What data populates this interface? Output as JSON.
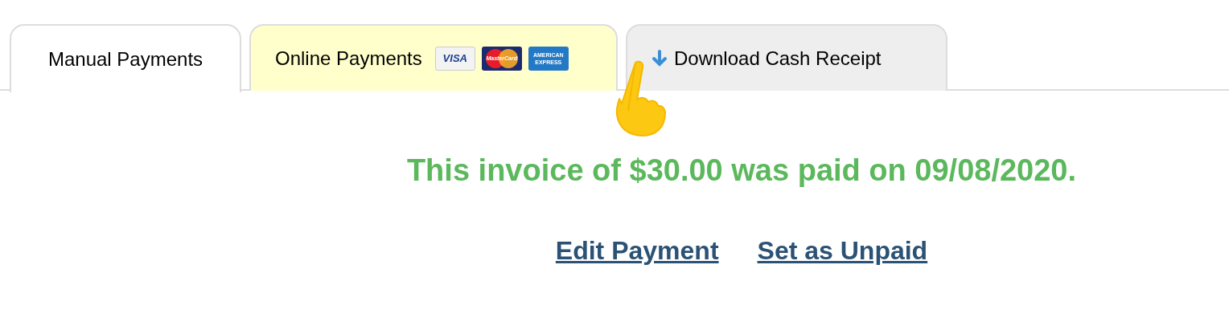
{
  "tabs": [
    {
      "label": "Manual Payments",
      "selected": true,
      "color": "#ffffff",
      "kind": "plain"
    },
    {
      "label": "Online Payments",
      "selected": false,
      "color": "#ffffcc",
      "kind": "cards",
      "cards": [
        {
          "kind": "visa",
          "lines": [
            "VISA"
          ]
        },
        {
          "kind": "mastercard",
          "lines": [
            "MasterCard"
          ]
        },
        {
          "kind": "amex",
          "lines": [
            "AMERICAN",
            "EXPRESS"
          ]
        }
      ]
    },
    {
      "label": "Download Cash Receipt",
      "selected": false,
      "color": "#eeeeee",
      "kind": "download"
    }
  ],
  "message": "This invoice of $30.00 was paid on 09/08/2020.",
  "links": [
    "Edit Payment",
    "Set as Unpaid"
  ]
}
